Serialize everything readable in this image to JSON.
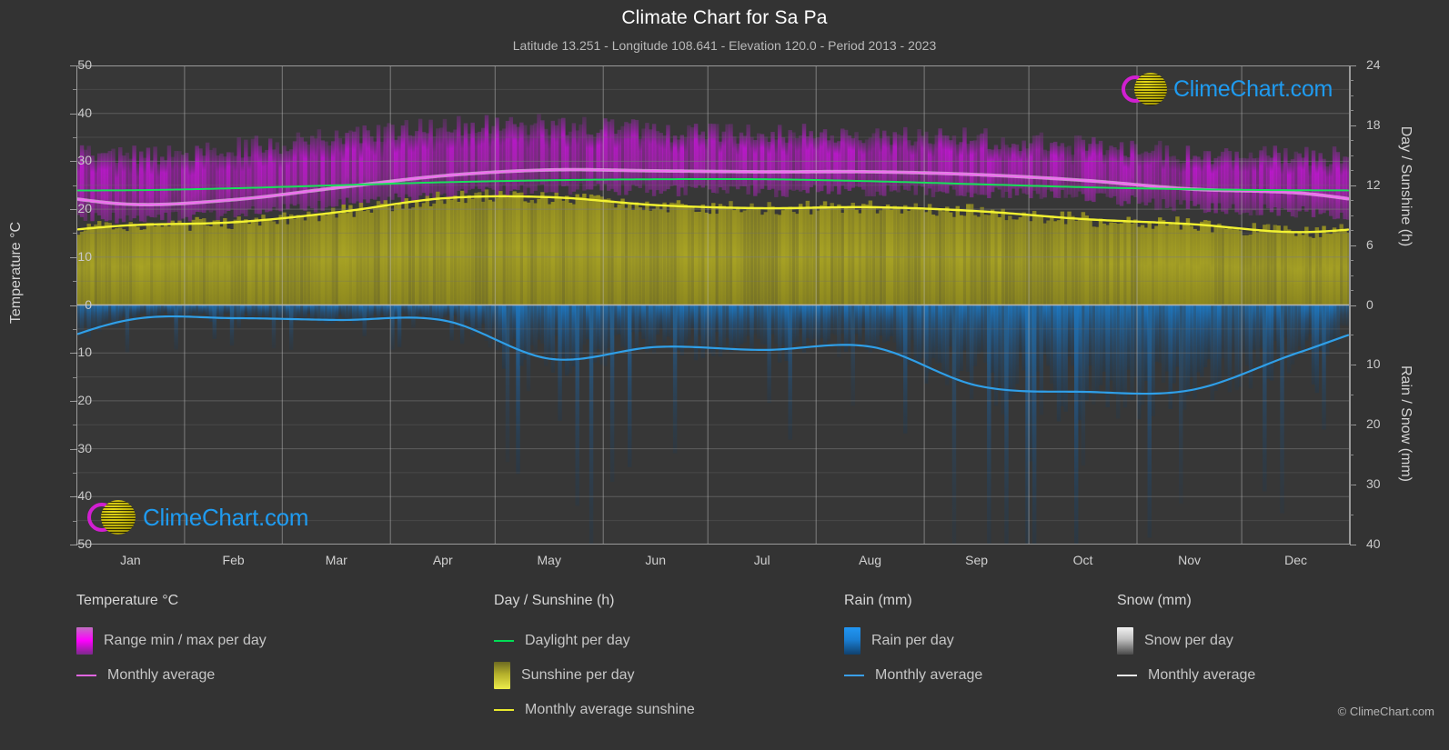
{
  "header": {
    "title": "Climate Chart for Sa Pa",
    "subtitle": "Latitude 13.251 - Longitude 108.641 - Elevation 120.0 - Period 2013 - 2023"
  },
  "axes": {
    "left_label": "Temperature °C",
    "right_label_top": "Day / Sunshine (h)",
    "right_label_bottom": "Rain / Snow (mm)",
    "left_ticks": [
      "50",
      "40",
      "30",
      "20",
      "10",
      "0",
      "-10",
      "-20",
      "-30",
      "-40",
      "-50"
    ],
    "right_ticks_top": [
      "24",
      "18",
      "12",
      "6",
      "0"
    ],
    "right_ticks_bottom": [
      "10",
      "20",
      "30",
      "40"
    ],
    "x_ticks": [
      "Jan",
      "Feb",
      "Mar",
      "Apr",
      "May",
      "Jun",
      "Jul",
      "Aug",
      "Sep",
      "Oct",
      "Nov",
      "Dec"
    ]
  },
  "legend": {
    "temperature": {
      "heading": "Temperature °C",
      "items": [
        {
          "label": "Range min / max per day",
          "mark": "swatch",
          "color": "#ff00ff"
        },
        {
          "label": "Monthly average",
          "mark": "line",
          "color": "#e066e0"
        }
      ]
    },
    "daysunshine": {
      "heading": "Day / Sunshine (h)",
      "items": [
        {
          "label": "Daylight per day",
          "mark": "line",
          "color": "#00dd55"
        },
        {
          "label": "Sunshine per day",
          "mark": "swatch",
          "color": "#ecec4a"
        },
        {
          "label": "Monthly average sunshine",
          "mark": "line",
          "color": "#e8e82e"
        }
      ]
    },
    "rain": {
      "heading": "Rain (mm)",
      "items": [
        {
          "label": "Rain per day",
          "mark": "swatch",
          "color": "#2196f3"
        },
        {
          "label": "Monthly average",
          "mark": "line",
          "color": "#3a9fe8"
        }
      ]
    },
    "snow": {
      "heading": "Snow (mm)",
      "items": [
        {
          "label": "Snow per day",
          "mark": "swatch",
          "color": "#f2f2f2"
        },
        {
          "label": "Monthly average",
          "mark": "line",
          "color": "#e8e8e8"
        }
      ]
    }
  },
  "branding": {
    "logo_text": "ClimeChart.com",
    "copyright": "© ClimeChart.com"
  },
  "chart_data": {
    "type": "line",
    "title": "Climate Chart for Sa Pa",
    "subtitle": "Latitude 13.251 - Longitude 108.641 - Elevation 120.0 - Period 2013 - 2023",
    "xlabel": "",
    "ylabel": "Temperature °C",
    "ylim": [
      -50,
      50
    ],
    "y2lim_top": [
      0,
      24
    ],
    "y2lim_bottom": [
      0,
      40
    ],
    "grid": true,
    "legend_position": "below",
    "categories": [
      "Jan",
      "Feb",
      "Mar",
      "Apr",
      "May",
      "Jun",
      "Jul",
      "Aug",
      "Sep",
      "Oct",
      "Nov",
      "Dec"
    ],
    "series": [
      {
        "name": "Monthly average temperature",
        "axis": "left",
        "unit": "°C",
        "color": "#e066e0",
        "values": [
          21.0,
          22.0,
          24.5,
          27.0,
          28.2,
          28.0,
          27.8,
          27.8,
          27.2,
          26.0,
          24.2,
          23.4
        ]
      },
      {
        "name": "Daily max temperature (range top)",
        "axis": "left",
        "unit": "°C",
        "color": "#ff00ff",
        "values": [
          31.0,
          32.5,
          35.0,
          37.0,
          37.5,
          36.0,
          35.5,
          35.5,
          34.5,
          33.0,
          31.5,
          31.0
        ]
      },
      {
        "name": "Daily min temperature (range bottom)",
        "axis": "left",
        "unit": "°C",
        "color": "#ff00ff",
        "values": [
          18.0,
          19.0,
          21.0,
          23.0,
          24.0,
          24.0,
          23.8,
          23.8,
          23.5,
          22.5,
          20.5,
          19.5
        ]
      },
      {
        "name": "Daylight per day",
        "axis": "right_top",
        "unit": "h",
        "color": "#00dd55",
        "values": [
          11.5,
          11.7,
          12.0,
          12.3,
          12.5,
          12.6,
          12.6,
          12.4,
          12.1,
          11.8,
          11.6,
          11.5
        ]
      },
      {
        "name": "Monthly average sunshine",
        "axis": "right_top",
        "unit": "h",
        "color": "#e8e82e",
        "values": [
          8.0,
          8.3,
          9.3,
          10.7,
          10.8,
          10.0,
          9.7,
          9.8,
          9.4,
          8.6,
          8.1,
          7.3
        ]
      },
      {
        "name": "Monthly average rain",
        "axis": "right_bottom",
        "unit": "mm",
        "color": "#3a9fe8",
        "values": [
          2.4,
          2.2,
          2.5,
          2.6,
          9.0,
          7.0,
          7.5,
          7.0,
          13.5,
          14.5,
          14.2,
          8.0
        ]
      },
      {
        "name": "Monthly average snow",
        "axis": "right_bottom",
        "unit": "mm",
        "color": "#e8e8e8",
        "values": [
          0,
          0,
          0,
          0,
          0,
          0,
          0,
          0,
          0,
          0,
          0,
          0
        ]
      }
    ]
  }
}
